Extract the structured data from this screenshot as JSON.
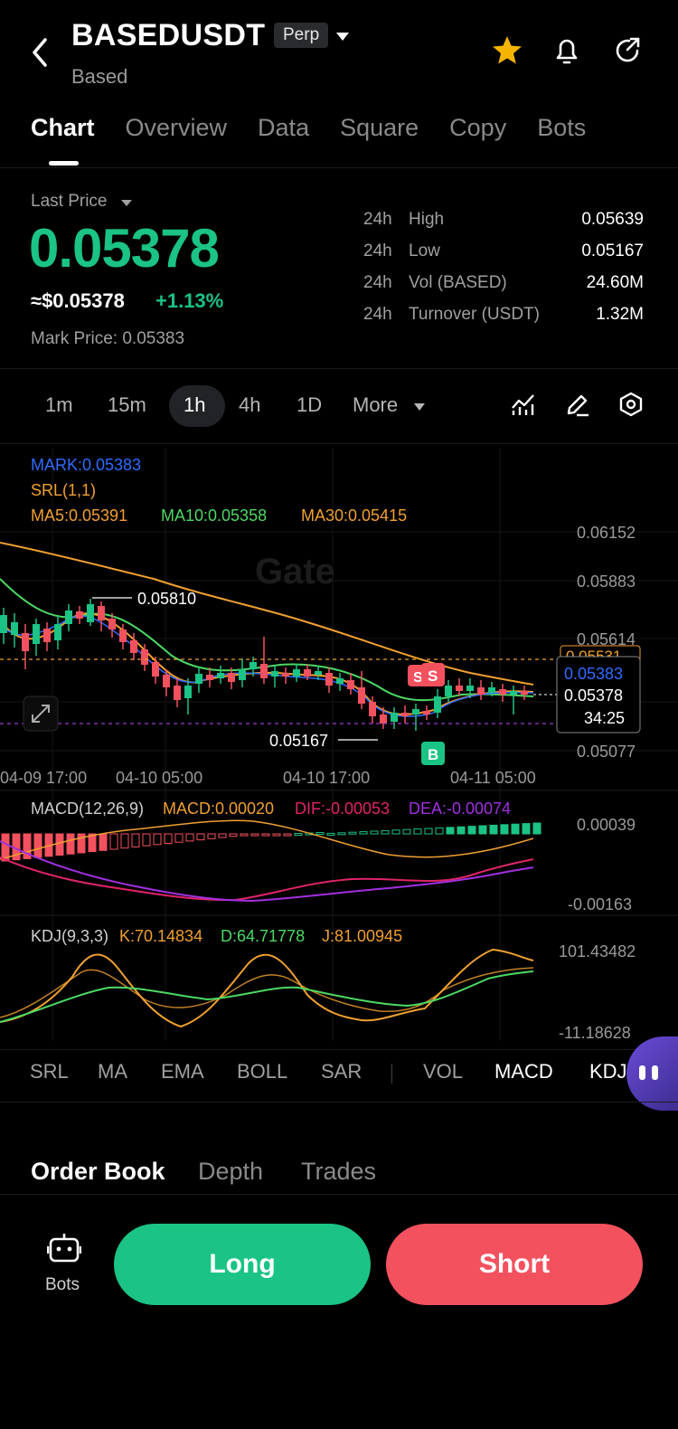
{
  "header": {
    "symbol": "BASEDUSDT",
    "contract_type": "Perp",
    "name": "Based"
  },
  "tabs": [
    "Chart",
    "Overview",
    "Data",
    "Square",
    "Copy",
    "Bots"
  ],
  "price": {
    "last_price_label": "Last Price",
    "last_price": "0.05378",
    "usd_price": "≈$0.05378",
    "change": "+1.13%",
    "mark_price": "Mark Price: 0.05383"
  },
  "stats": [
    {
      "period": "24h",
      "label": "High",
      "value": "0.05639"
    },
    {
      "period": "24h",
      "label": "Low",
      "value": "0.05167"
    },
    {
      "period": "24h",
      "label": "Vol (BASED)",
      "value": "24.60M"
    },
    {
      "period": "24h",
      "label": "Turnover (USDT)",
      "value": "1.32M"
    }
  ],
  "intervals": [
    "1m",
    "15m",
    "1h",
    "4h",
    "1D",
    "More"
  ],
  "active_interval": "1h",
  "chart_legend": {
    "mark": "MARK:0.05383",
    "srl": "SRL(1,1)",
    "ma5": "MA5:0.05391",
    "ma10": "MA10:0.05358",
    "ma30": "MA30:0.05415"
  },
  "price_axis": [
    "0.06152",
    "0.05883",
    "0.05614",
    "0.05531",
    "0.05077"
  ],
  "time_axis": [
    "04-09 17:00",
    "04-10 05:00",
    "04-10 17:00",
    "04-11 05:00"
  ],
  "annotations": {
    "high": "0.05810",
    "low": "0.05167",
    "mark_tag": "0.05383",
    "last_tag": "0.05378",
    "countdown": "34:25",
    "sell_marker": "S",
    "buy_marker": "B",
    "watermark": "Gate"
  },
  "macd": {
    "label": "MACD(12,26,9)",
    "macd": "MACD:0.00020",
    "dif": "DIF:-0.00053",
    "dea": "DEA:-0.00074",
    "axis_top": "0.00039",
    "axis_bottom": "-0.00163"
  },
  "kdj": {
    "label": "KDJ(9,3,3)",
    "k": "K:70.14834",
    "d": "D:64.71778",
    "j": "J:81.00945",
    "axis_top": "101.43482",
    "axis_bottom": "-11.18628"
  },
  "indicators": {
    "main": [
      "SRL",
      "MA",
      "EMA",
      "BOLL",
      "SAR"
    ],
    "sub": [
      "VOL",
      "MACD",
      "KDJ"
    ],
    "active_sub": [
      "MACD",
      "KDJ"
    ]
  },
  "orderbook_tabs": [
    "Order Book",
    "Depth",
    "Trades"
  ],
  "bottom": {
    "bots_label": "Bots",
    "long_label": "Long",
    "short_label": "Short"
  },
  "colors": {
    "up": "#1bc384",
    "down": "#f4515f",
    "ma5": "#f0a030",
    "ma10": "#4cd964",
    "ma30": "#f0a030",
    "mark": "#2f6bff"
  }
}
